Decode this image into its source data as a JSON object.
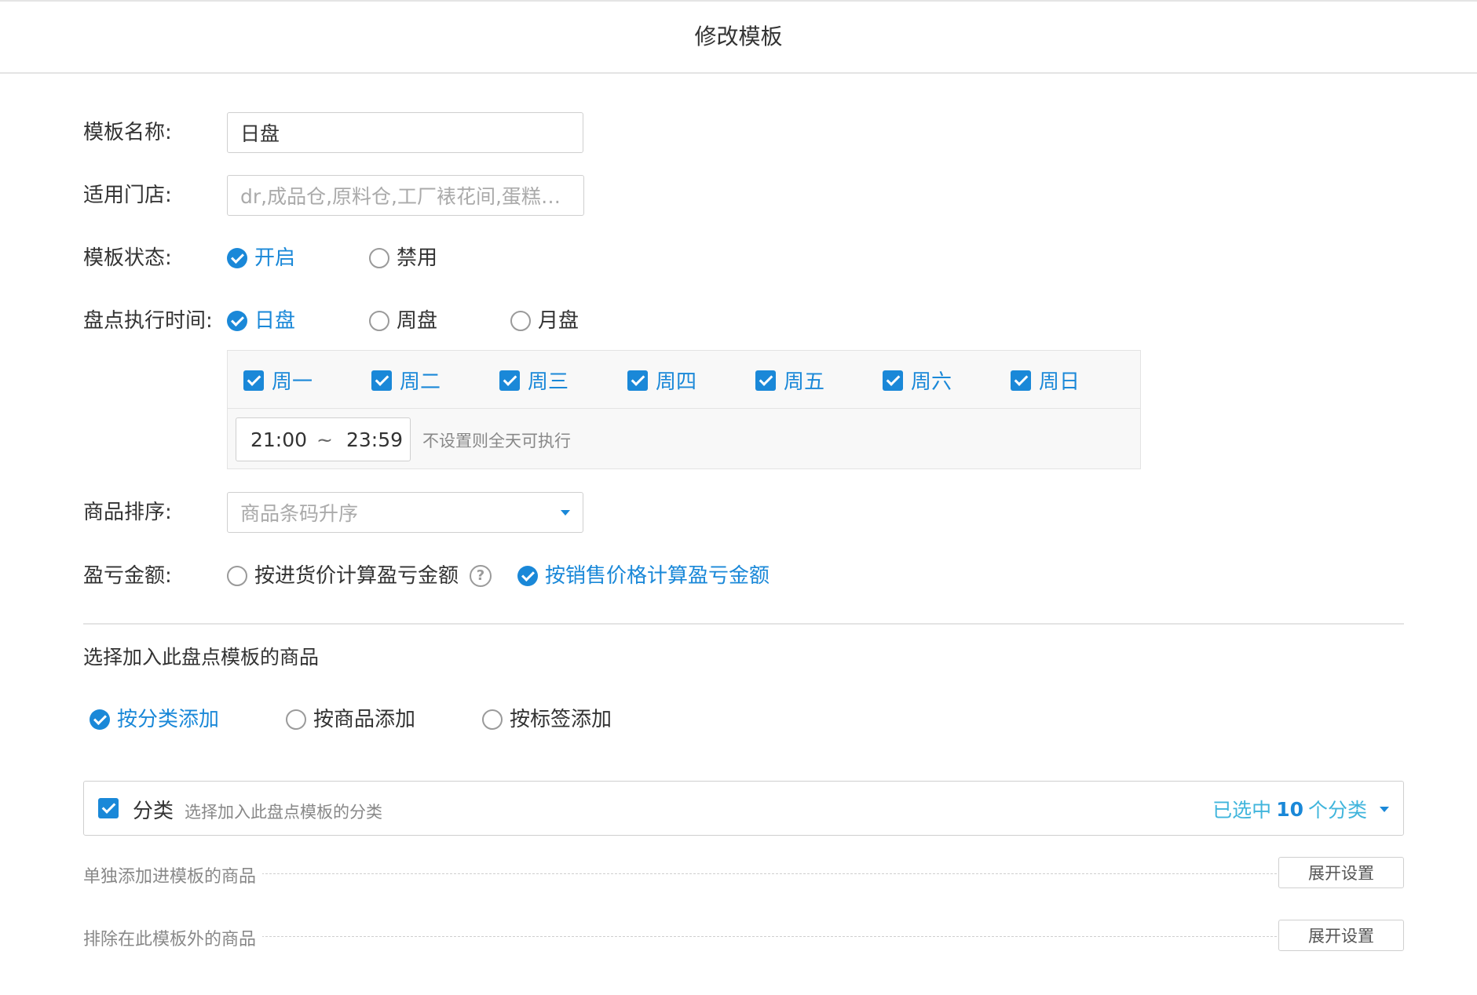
{
  "header": {
    "title": "修改模板"
  },
  "form": {
    "name": {
      "label": "模板名称:",
      "value": "日盘"
    },
    "stores": {
      "label": "适用门店:",
      "placeholder": "dr,成品仓,原料仓,工厂裱花间,蛋糕组..."
    },
    "status": {
      "label": "模板状态:",
      "options": [
        "开启",
        "禁用"
      ],
      "selected": "开启"
    },
    "exec_time": {
      "label": "盘点执行时间:",
      "options": [
        "日盘",
        "周盘",
        "月盘"
      ],
      "selected": "日盘",
      "days": [
        "周一",
        "周二",
        "周三",
        "周四",
        "周五",
        "周六",
        "周日"
      ],
      "time_start": "21:00",
      "time_sep": "~",
      "time_end": "23:59",
      "time_hint": "不设置则全天可执行"
    },
    "sort": {
      "label": "商品排序:",
      "placeholder": "商品条码升序"
    },
    "profit": {
      "label": "盈亏金额:",
      "options": [
        "按进货价计算盈亏金额",
        "按销售价格计算盈亏金额"
      ],
      "selected": "按销售价格计算盈亏金额",
      "help_icon": "question-circle-icon",
      "help_glyph": "?"
    }
  },
  "products": {
    "section_title": "选择加入此盘点模板的商品",
    "add_modes": [
      "按分类添加",
      "按商品添加",
      "按标签添加"
    ],
    "selected_mode": "按分类添加",
    "category": {
      "label": "分类",
      "hint": "选择加入此盘点模板的分类",
      "selected_prefix": "已选中",
      "selected_count": "10",
      "selected_suffix": "个分类"
    },
    "include": {
      "label": "单独添加进模板的商品",
      "button": "展开设置"
    },
    "exclude": {
      "label": "排除在此模板外的商品",
      "button": "展开设置"
    }
  },
  "colors": {
    "accent": "#1a88d8",
    "accent_light": "#40b5dc",
    "border": "#cfcfcf"
  }
}
